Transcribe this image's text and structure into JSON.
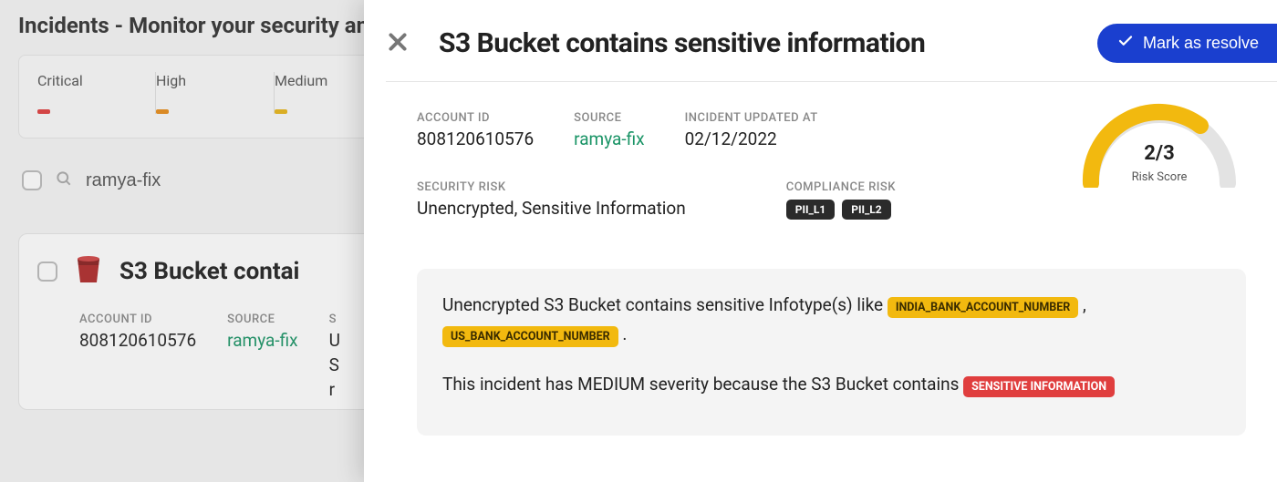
{
  "page": {
    "title": "Incidents - Monitor your security and",
    "severities": [
      {
        "label": "Critical",
        "class": "crit"
      },
      {
        "label": "High",
        "class": "high"
      },
      {
        "label": "Medium",
        "class": "med"
      }
    ],
    "search_value": "ramya-fix"
  },
  "card": {
    "title": "S3 Bucket contai",
    "account_id_label": "ACCOUNT ID",
    "account_id": "808120610576",
    "source_label": "SOURCE",
    "source": "ramya-fix",
    "col3_label": "S",
    "col3_l1": "U",
    "col3_l2": "S",
    "col3_l3": "r"
  },
  "panel": {
    "title": "S3 Bucket contains sensitive information",
    "resolve_label": "Mark as resolve",
    "account_id_label": "ACCOUNT ID",
    "account_id": "808120610576",
    "source_label": "SOURCE",
    "source": "ramya-fix",
    "updated_label": "INCIDENT UPDATED AT",
    "updated": "02/12/2022",
    "risk_score_value": "2/3",
    "risk_score_label": "Risk Score",
    "sec_risk_label": "SECURITY RISK",
    "sec_risk_value": "Unencrypted, Sensitive Information",
    "comp_risk_label": "COMPLIANCE RISK",
    "comp_risk_tags": [
      "PII_L1",
      "PII_L2"
    ],
    "desc_line1_pre": "Unencrypted S3 Bucket contains sensitive Infotype(s) like ",
    "desc_tag1": "INDIA_BANK_ACCOUNT_NUMBER",
    "desc_mid": ",",
    "desc_tag2": "US_BANK_ACCOUNT_NUMBER",
    "desc_line1_post": ".",
    "desc_line2_pre": "This incident has MEDIUM severity because the S3 Bucket contains ",
    "desc_tag3": "SENSITIVE INFORMATION"
  }
}
